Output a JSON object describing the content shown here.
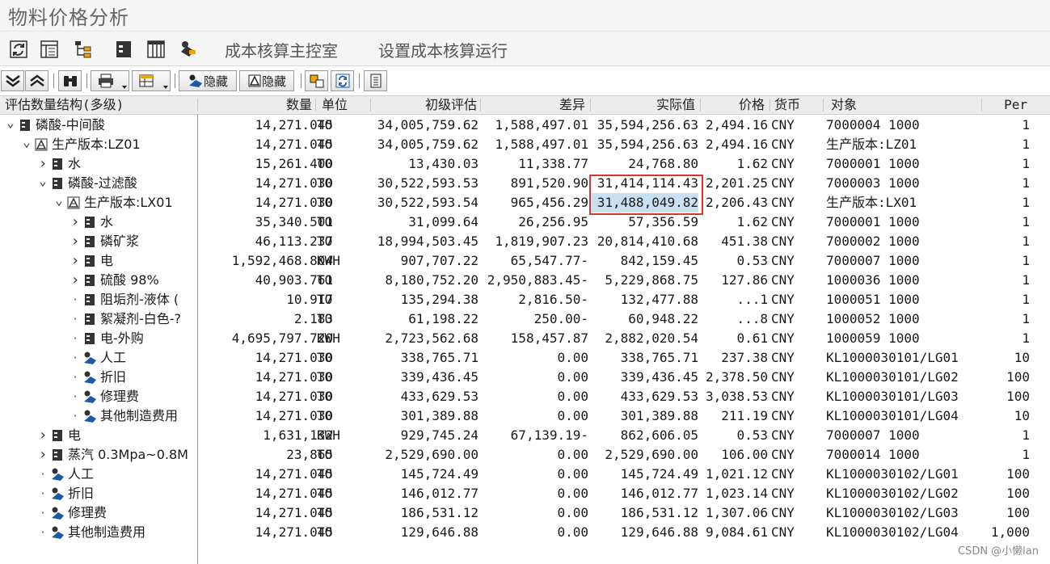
{
  "window": {
    "title": "物料价格分析"
  },
  "app_toolbar": {
    "menu1": "成本核算主控室",
    "menu2": "设置成本核算运行"
  },
  "alv_toolbar": {
    "hide1_label": "隐藏",
    "hide2_label": "隐藏"
  },
  "columns": {
    "tree": "评估数量结构(多级)",
    "qty": "数量",
    "unit": "单位",
    "initial": "初级评估",
    "diff": "差异",
    "actual": "实际值",
    "price": "价格",
    "currency": "货币",
    "object": "对象",
    "per": "Per"
  },
  "rows": [
    {
      "level": 0,
      "toggle": "open",
      "icon": "material-icon",
      "label": "磷酸-中间酸",
      "qty": "14,271.045",
      "unit": "TO",
      "initial": "34,005,759.62",
      "diff": "1,588,497.01",
      "actual": "35,594,256.63",
      "price": "2,494.16",
      "cur": "CNY",
      "obj": "7000004 1000",
      "per": "1"
    },
    {
      "level": 1,
      "toggle": "open",
      "icon": "production-version-icon",
      "label": "生产版本:LZ01",
      "qty": "14,271.045",
      "unit": "TO",
      "initial": "34,005,759.62",
      "diff": "1,588,497.01",
      "actual": "35,594,256.63",
      "price": "2,494.16",
      "cur": "CNY",
      "obj": "生产版本:LZ01",
      "per": "1"
    },
    {
      "level": 2,
      "toggle": "closed",
      "icon": "material-icon",
      "label": "水",
      "qty": "15,261.400",
      "unit": "TO",
      "initial": "13,430.03",
      "diff": "11,338.77",
      "actual": "24,768.80",
      "price": "1.62",
      "cur": "CNY",
      "obj": "7000001 1000",
      "per": "1"
    },
    {
      "level": 2,
      "toggle": "open",
      "icon": "material-icon",
      "label": "磷酸-过滤酸",
      "qty": "14,271.030",
      "unit": "TO",
      "initial": "30,522,593.53",
      "diff": "891,520.90",
      "actual": "31,414,114.43",
      "price": "2,201.25",
      "cur": "CNY",
      "obj": "7000003 1000",
      "per": "1"
    },
    {
      "level": 3,
      "toggle": "open",
      "icon": "production-version-icon",
      "label": "生产版本:LX01",
      "qty": "14,271.030",
      "unit": "TO",
      "initial": "30,522,593.54",
      "diff": "965,456.29",
      "actual": "31,488,049.82",
      "price": "2,206.43",
      "cur": "CNY",
      "obj": "生产版本:LX01",
      "per": "1",
      "highlight": true
    },
    {
      "level": 4,
      "toggle": "closed",
      "icon": "material-icon",
      "label": "水",
      "qty": "35,340.501",
      "unit": "TO",
      "initial": "31,099.64",
      "diff": "26,256.95",
      "actual": "57,356.59",
      "price": "1.62",
      "cur": "CNY",
      "obj": "7000001 1000",
      "per": "1"
    },
    {
      "level": 4,
      "toggle": "closed",
      "icon": "material-icon",
      "label": "磷矿浆",
      "qty": "46,113.237",
      "unit": "TO",
      "initial": "18,994,503.45",
      "diff": "1,819,907.23",
      "actual": "20,814,410.68",
      "price": "451.38",
      "cur": "CNY",
      "obj": "7000002 1000",
      "per": "1"
    },
    {
      "level": 4,
      "toggle": "closed",
      "icon": "material-icon",
      "label": "电",
      "qty": "1,592,468.804",
      "unit": "KWH",
      "initial": "907,707.22",
      "diff": "65,547.77-",
      "actual": "842,159.45",
      "price": "0.53",
      "cur": "CNY",
      "obj": "7000007 1000",
      "per": "1"
    },
    {
      "level": 4,
      "toggle": "closed",
      "icon": "material-icon",
      "label": "硫酸 98%",
      "qty": "40,903.761",
      "unit": "TO",
      "initial": "8,180,752.20",
      "diff": "2,950,883.45-",
      "actual": "5,229,868.75",
      "price": "127.86",
      "cur": "CNY",
      "obj": "1000036 1000",
      "per": "1"
    },
    {
      "level": 4,
      "toggle": "leaf",
      "icon": "material-icon",
      "label": "阻垢剂-液体 (",
      "qty": "10.917",
      "unit": "TO",
      "initial": "135,294.38",
      "diff": "2,816.50-",
      "actual": "132,477.88",
      "price": "...1",
      "cur": "CNY",
      "obj": "1000051 1000",
      "per": "1"
    },
    {
      "level": 4,
      "toggle": "leaf",
      "icon": "material-icon",
      "label": "絮凝剂-白色-?",
      "qty": "2.183",
      "unit": "TO",
      "initial": "61,198.22",
      "diff": "250.00-",
      "actual": "60,948.22",
      "price": "...8",
      "cur": "CNY",
      "obj": "1000052 1000",
      "per": "1"
    },
    {
      "level": 4,
      "toggle": "leaf",
      "icon": "material-icon",
      "label": "电-外购",
      "qty": "4,695,797.720",
      "unit": "KWH",
      "initial": "2,723,562.68",
      "diff": "158,457.87",
      "actual": "2,882,020.54",
      "price": "0.61",
      "cur": "CNY",
      "obj": "1000059 1000",
      "per": "1"
    },
    {
      "level": 4,
      "toggle": "leaf",
      "icon": "activity-icon",
      "label": "人工",
      "qty": "14,271.030",
      "unit": "TO",
      "initial": "338,765.71",
      "diff": "0.00",
      "actual": "338,765.71",
      "price": "237.38",
      "cur": "CNY",
      "obj": "KL1000030101/LG01",
      "per": "10"
    },
    {
      "level": 4,
      "toggle": "leaf",
      "icon": "activity-icon",
      "label": "折旧",
      "qty": "14,271.030",
      "unit": "TO",
      "initial": "339,436.45",
      "diff": "0.00",
      "actual": "339,436.45",
      "price": "2,378.50",
      "cur": "CNY",
      "obj": "KL1000030101/LG02",
      "per": "100"
    },
    {
      "level": 4,
      "toggle": "leaf",
      "icon": "activity-icon",
      "label": "修理费",
      "qty": "14,271.030",
      "unit": "TO",
      "initial": "433,629.53",
      "diff": "0.00",
      "actual": "433,629.53",
      "price": "3,038.53",
      "cur": "CNY",
      "obj": "KL1000030101/LG03",
      "per": "100"
    },
    {
      "level": 4,
      "toggle": "leaf",
      "icon": "activity-icon",
      "label": "其他制造费用",
      "qty": "14,271.030",
      "unit": "TO",
      "initial": "301,389.88",
      "diff": "0.00",
      "actual": "301,389.88",
      "price": "211.19",
      "cur": "CNY",
      "obj": "KL1000030101/LG04",
      "per": "10"
    },
    {
      "level": 2,
      "toggle": "closed",
      "icon": "material-icon",
      "label": "电",
      "qty": "1,631,132",
      "unit": "KWH",
      "initial": "929,745.24",
      "diff": "67,139.19-",
      "actual": "862,606.05",
      "price": "0.53",
      "cur": "CNY",
      "obj": "7000007 1000",
      "per": "1"
    },
    {
      "level": 2,
      "toggle": "closed",
      "icon": "material-icon",
      "label": "蒸汽 0.3Mpa~0.8M",
      "qty": "23,865",
      "unit": "TO",
      "initial": "2,529,690.00",
      "diff": "0.00",
      "actual": "2,529,690.00",
      "price": "106.00",
      "cur": "CNY",
      "obj": "7000014 1000",
      "per": "1"
    },
    {
      "level": 2,
      "toggle": "leaf",
      "icon": "activity-icon",
      "label": "人工",
      "qty": "14,271.045",
      "unit": "TO",
      "initial": "145,724.49",
      "diff": "0.00",
      "actual": "145,724.49",
      "price": "1,021.12",
      "cur": "CNY",
      "obj": "KL1000030102/LG01",
      "per": "100"
    },
    {
      "level": 2,
      "toggle": "leaf",
      "icon": "activity-icon",
      "label": "折旧",
      "qty": "14,271.045",
      "unit": "TO",
      "initial": "146,012.77",
      "diff": "0.00",
      "actual": "146,012.77",
      "price": "1,023.14",
      "cur": "CNY",
      "obj": "KL1000030102/LG02",
      "per": "100"
    },
    {
      "level": 2,
      "toggle": "leaf",
      "icon": "activity-icon",
      "label": "修理费",
      "qty": "14,271.045",
      "unit": "TO",
      "initial": "186,531.12",
      "diff": "0.00",
      "actual": "186,531.12",
      "price": "1,307.06",
      "cur": "CNY",
      "obj": "KL1000030102/LG03",
      "per": "100"
    },
    {
      "level": 2,
      "toggle": "leaf",
      "icon": "activity-icon",
      "label": "其他制造费用",
      "qty": "14,271.045",
      "unit": "TO",
      "initial": "129,646.88",
      "diff": "0.00",
      "actual": "129,646.88",
      "price": "9,084.61",
      "cur": "CNY",
      "obj": "KL1000030102/LG04",
      "per": "1,000"
    }
  ],
  "watermark": "CSDN @小懒lan"
}
